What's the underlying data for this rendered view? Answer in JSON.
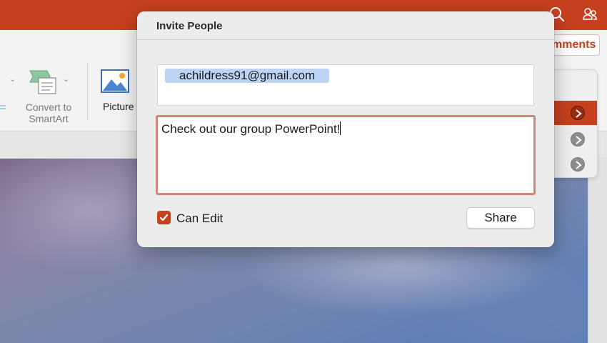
{
  "app": {
    "titlebar_color": "#c6401f",
    "search_icon": "search-icon",
    "share_people_icon": "people-icon"
  },
  "ribbon": {
    "convert_to_smartart_label_line1": "Convert to",
    "convert_to_smartart_label_line2": "SmartArt",
    "picture_label": "Picture",
    "comments_label": "mments"
  },
  "dialog": {
    "title": "Invite People",
    "recipient_email": "achildress91@gmail.com",
    "message": "Check out our group PowerPoint!",
    "can_edit_label": "Can Edit",
    "can_edit_checked": true,
    "share_label": "Share"
  },
  "colors": {
    "accent": "#c6401f",
    "focus_ring": "#d08678",
    "email_chip": "#bcd3f3"
  }
}
